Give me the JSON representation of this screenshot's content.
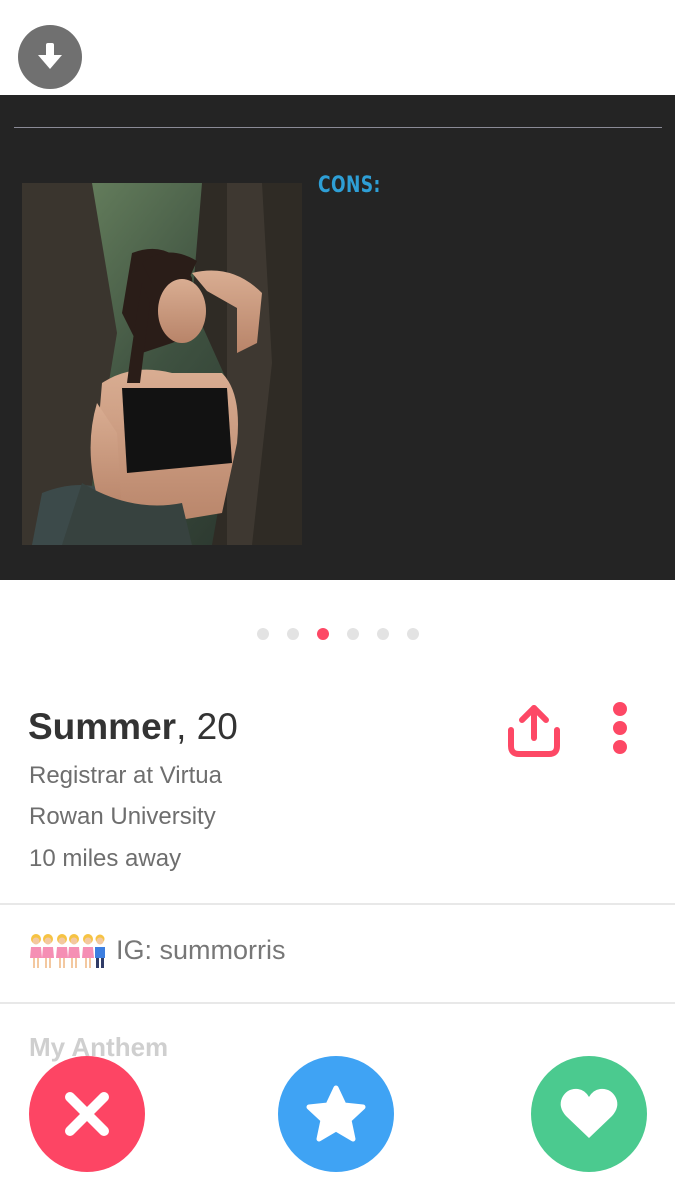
{
  "photo": {
    "caption_label": "CONS:",
    "carousel": {
      "count": 6,
      "active_index": 2
    }
  },
  "profile": {
    "name": "Summer",
    "age_text": ", 20",
    "job": "Registrar at Virtua",
    "school": "Rowan University",
    "distance": "10 miles away"
  },
  "bio": {
    "emoji_icons": [
      "girl-girl-holding-hands-emoji",
      "girl-girl-holding-hands-emoji",
      "girl-boy-holding-hands-emoji"
    ],
    "text": "IG: summorris"
  },
  "anthem": {
    "label": "My Anthem"
  },
  "colors": {
    "brand_red": "#fd4865",
    "nope": "#fd4564",
    "super_like": "#3fa3f4",
    "like": "#4bca8f",
    "cons_text": "#2e9fd6"
  },
  "actions": {
    "nope_icon": "x-icon",
    "super_like_icon": "star-icon",
    "like_icon": "heart-icon",
    "share_icon": "share-icon",
    "more_icon": "more-vertical-icon",
    "download_icon": "arrow-down-icon"
  }
}
